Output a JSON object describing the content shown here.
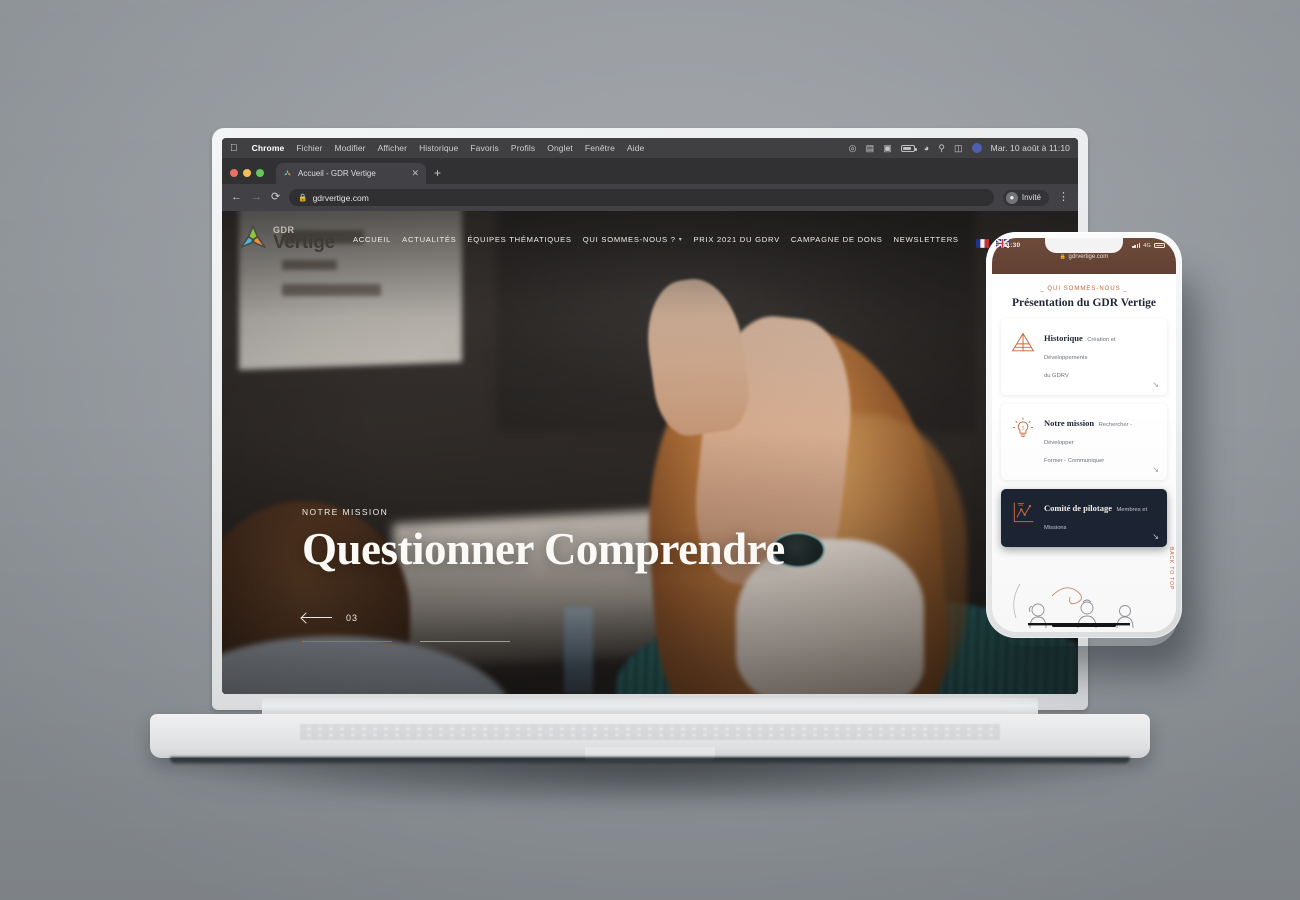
{
  "os": {
    "menu_items": [
      "Chrome",
      "Fichier",
      "Modifier",
      "Afficher",
      "Historique",
      "Favoris",
      "Profils",
      "Onglet",
      "Fenêtre",
      "Aide"
    ],
    "apple_icon": "apple-icon",
    "clock": "Mar. 10 août à 11:10",
    "tray_icons": [
      "airplay-icon",
      "malwarebytes-icon",
      "keyboard-icon",
      "battery-icon",
      "wifi-icon",
      "search-icon",
      "control-center-icon",
      "notification-icon"
    ]
  },
  "browser": {
    "tab": {
      "title": "Accueil - GDR Vertige",
      "favicon": "site-favicon",
      "close_label": "✕"
    },
    "new_tab_label": "+",
    "back_label": "←",
    "forward_label": "→",
    "reload_label": "⟳",
    "omnibox": {
      "lock_icon": "lock-icon",
      "url": "gdrvertige.com"
    },
    "profile": {
      "label": "Invité",
      "avatar_icon": "person-icon"
    },
    "menu_label": "⋮"
  },
  "site": {
    "brand": {
      "top": "GDR",
      "name": "Vertige",
      "mark": "pinwheel-logo-icon"
    },
    "nav": [
      {
        "label": "ACCUEIL",
        "has_caret": false
      },
      {
        "label": "ACTUALITÉS",
        "has_caret": false
      },
      {
        "label": "ÉQUIPES THÉMATIQUES",
        "has_caret": false
      },
      {
        "label": "QUI SOMMES-NOUS ?",
        "has_caret": true
      },
      {
        "label": "PRIX 2021 DU GDRV",
        "has_caret": false
      },
      {
        "label": "CAMPAGNE DE DONS",
        "has_caret": false
      },
      {
        "label": "NEWSLETTERS",
        "has_caret": false
      }
    ],
    "languages": [
      "flag-fr-icon",
      "flag-en-icon"
    ],
    "hero": {
      "eyebrow": "NOTRE MISSION",
      "title": "Questionner Comprendre",
      "slide_number": "03",
      "prev_label": "previous-slide",
      "slides_total": 2,
      "active_slide_index": 0
    }
  },
  "phone": {
    "status": {
      "time": "11:30",
      "network": "4G",
      "signal_icon": "signal-icon",
      "battery_icon": "battery-icon"
    },
    "url": "gdrvertige.com",
    "kicker": "_ QUI SOMMES-NOUS _",
    "heading": "Présentation du GDR Vertige",
    "cards": [
      {
        "title": "Historique",
        "lines": [
          "Création et Développements",
          "du GDRV"
        ],
        "icon": "pyramid-icon",
        "dark": false,
        "arrow": "↘"
      },
      {
        "title": "Notre mission",
        "lines": [
          "Rechercher - Développer",
          "Former - Communiquer"
        ],
        "icon": "lightbulb-icon",
        "dark": false,
        "arrow": "↘"
      },
      {
        "title": "Comité de pilotage",
        "lines": [
          "Membres et Missions"
        ],
        "icon": "chart-icon",
        "dark": true,
        "arrow": "↘"
      }
    ],
    "back_to_top": "BACK TO TOP",
    "illustration": "people-line-art-icon"
  },
  "colors": {
    "accent": "#c4643a",
    "dark_navy": "#1c2433",
    "logo_blue": "#4fb8d8",
    "logo_green": "#8cc63f",
    "logo_orange": "#f08a3c",
    "background": "#9a9ea3",
    "safari_brown": "#6b4636"
  }
}
